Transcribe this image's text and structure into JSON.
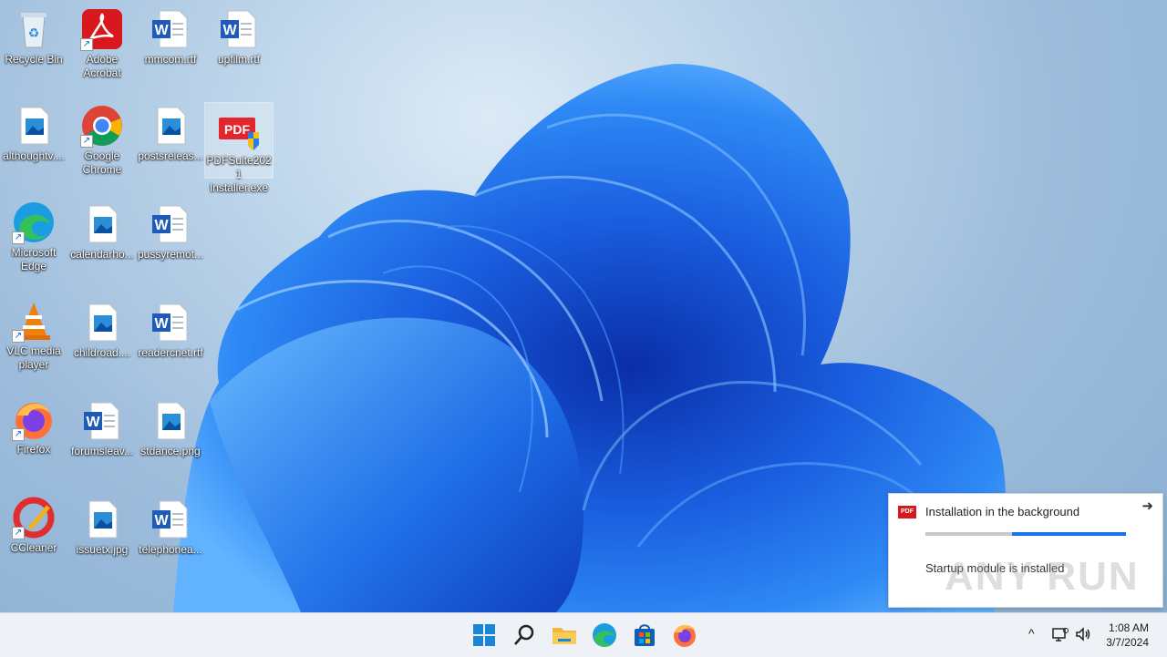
{
  "desktop": {
    "icons": [
      {
        "label": "Recycle Bin"
      },
      {
        "label": "Adobe Acrobat"
      },
      {
        "label": "mmcom.rtf"
      },
      {
        "label": "upfilm.rtf"
      },
      {
        "label": "althoughtv...."
      },
      {
        "label": "Google Chrome"
      },
      {
        "label": "postsreleas..."
      },
      {
        "label": "PDFSuite2021 Installer.exe"
      },
      {
        "label": "Microsoft Edge"
      },
      {
        "label": "calendarho..."
      },
      {
        "label": "pussyremot..."
      },
      {
        "label": "VLC media player"
      },
      {
        "label": "childroad...."
      },
      {
        "label": "readercnet.rtf"
      },
      {
        "label": "Firefox"
      },
      {
        "label": "forumsleav..."
      },
      {
        "label": "stdance.png"
      },
      {
        "label": "CCleaner"
      },
      {
        "label": "issuetx.jpg"
      },
      {
        "label": "telephonea..."
      }
    ]
  },
  "toast": {
    "title": "Installation in the background",
    "message": "Startup module is installed",
    "progress": 0.57,
    "close_glyph": "➜"
  },
  "watermark": "ANY RUN",
  "taskbar": {
    "apps": [
      "start-icon",
      "search-icon",
      "file-explorer-icon",
      "edge-icon",
      "store-icon",
      "firefox-icon"
    ],
    "tray": {
      "time": "1:08 AM",
      "date": "3/7/2024",
      "chevron": "^"
    }
  },
  "colors": {
    "accent": "#1a73e8",
    "bloom": "#1f6fe8",
    "taskbar": "#eef1f6"
  }
}
